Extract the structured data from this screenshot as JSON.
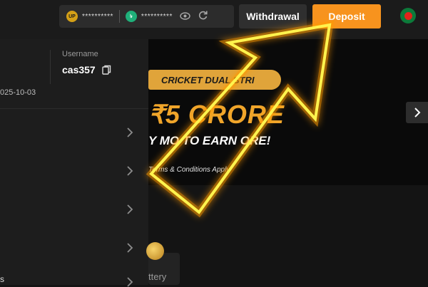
{
  "header": {
    "balance_up": "**********",
    "balance_taka": "**********",
    "up_coin_label": "UP",
    "taka_coin_label": "৳",
    "withdraw_label": "Withdrawal",
    "deposit_label": "Deposit"
  },
  "profile": {
    "username_label": "Username",
    "username": "cas357",
    "date": "025-10-03"
  },
  "banner": {
    "tag": "CRICKET DUAL STRI",
    "amount": "₹5 CRORE",
    "tagline": "Y MO  TO EARN  ORE!",
    "terms": "Terms & Conditions Apply"
  },
  "categories": {
    "lottery_label": "ttery"
  },
  "sidebar_edge_text": "s",
  "colors": {
    "deposit": "#f7931e",
    "arrow_glow": "#ffd400"
  }
}
